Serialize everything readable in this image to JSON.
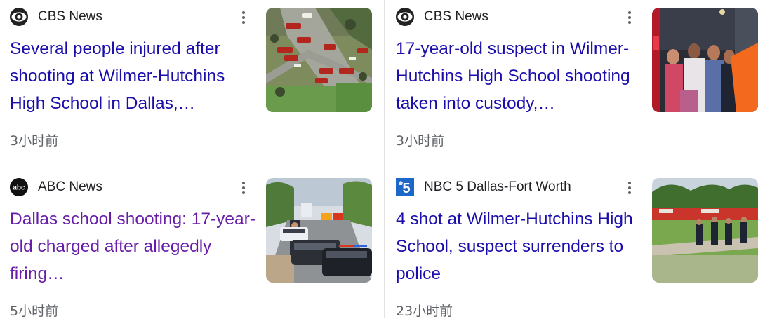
{
  "cards": [
    {
      "source": "CBS News",
      "source_logo_icon": "cbs-eye-logo-icon",
      "headline": "Several people injured after shooting at Wilmer-Hutchins High School in Dallas,…",
      "time": "3小时前",
      "visited": false,
      "thumbnail": "aerial-view-emergency-vehicles-image"
    },
    {
      "source": "CBS News",
      "source_logo_icon": "cbs-eye-logo-icon",
      "headline": "17-year-old suspect in Wilmer-Hutchins High School shooting taken into custody,…",
      "time": "3小时前",
      "visited": false,
      "thumbnail": "crowd-at-night-image"
    },
    {
      "source": "ABC News",
      "source_logo_icon": "abc-logo-icon",
      "headline": "Dallas school shooting: 17-year-old charged after allegedly firing…",
      "time": "5小时前",
      "visited": true,
      "thumbnail": "police-cars-on-street-image"
    },
    {
      "source": "NBC 5 Dallas-Fort Worth",
      "source_logo_icon": "nbc5-logo-icon",
      "headline": "4 shot at Wilmer-Hutchins High School, suspect surrenders to police",
      "time": "23小时前",
      "visited": false,
      "thumbnail": "fire-trucks-on-lawn-image"
    }
  ],
  "colors": {
    "link": "#1a0dab",
    "visited_link": "#681da8",
    "meta_text": "#5f6368",
    "source_text": "#202124",
    "divider": "#e3e3e3",
    "nbc_blue": "#1d67c9"
  }
}
